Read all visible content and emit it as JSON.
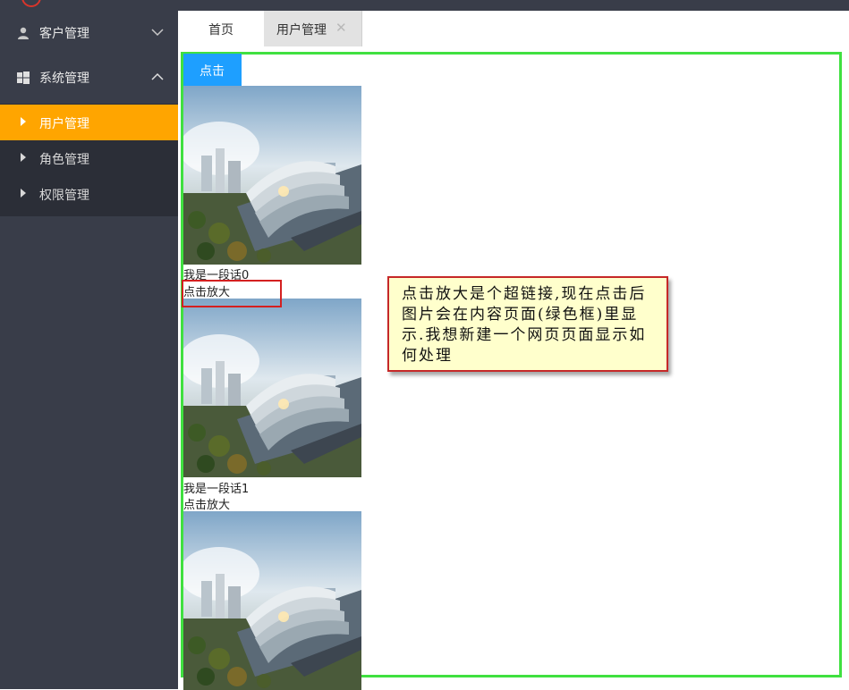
{
  "sidebar": {
    "groups": [
      {
        "label": "客户管理",
        "icon": "user-icon",
        "state": "collapsed"
      },
      {
        "label": "系统管理",
        "icon": "windows-icon",
        "state": "expanded"
      }
    ],
    "subitems": [
      {
        "label": "用户管理",
        "active": true
      },
      {
        "label": "角色管理",
        "active": false
      },
      {
        "label": "权限管理",
        "active": false
      }
    ]
  },
  "tabs": {
    "home": "首页",
    "users": "用户管理",
    "close": "✕"
  },
  "content": {
    "button_label": "点击",
    "items": [
      {
        "text": "我是一段话0",
        "link": "点击放大"
      },
      {
        "text": "我是一段话1",
        "link": "点击放大"
      }
    ]
  },
  "annotation": {
    "text": "点击放大是个超链接,现在点击后图片会在内容页面(绿色框)里显示.我想新建一个网页页面显示如何处理"
  },
  "colors": {
    "sidebar_bg": "#393d49",
    "submenu_bg": "#2b2e37",
    "active_item": "#ffa500",
    "button_blue": "#1e9fff",
    "frame_green": "#40e040",
    "highlight_red": "#d42020",
    "note_bg": "#ffffcc"
  }
}
